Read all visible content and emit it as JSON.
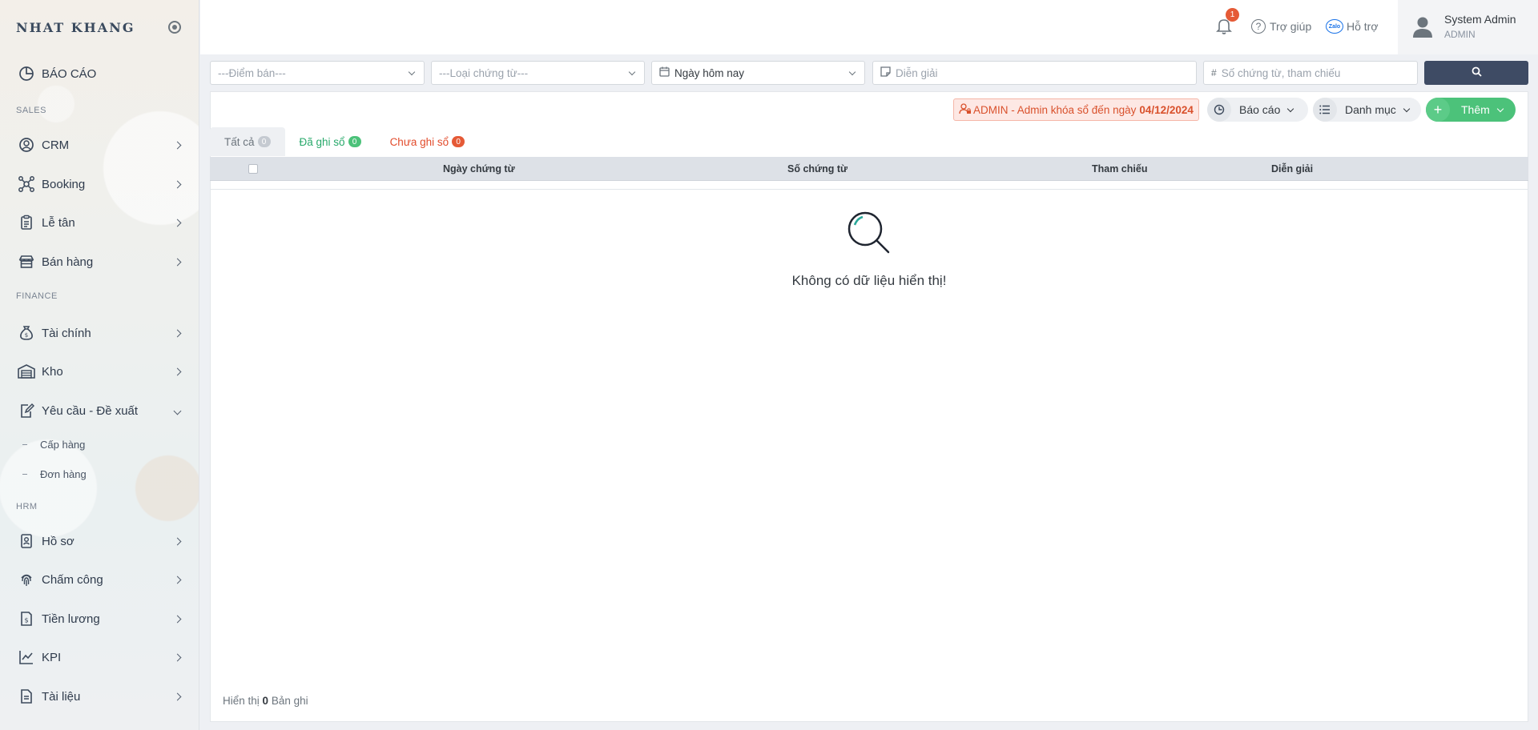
{
  "brand": {
    "name": "NHAT KHANG"
  },
  "sidebar": {
    "report": "BÁO CÁO",
    "sections": {
      "sales": "SALES",
      "finance": "FINANCE",
      "hrm": "HRM"
    },
    "items": {
      "crm": "CRM",
      "booking": "Booking",
      "reception": "Lễ tân",
      "sales": "Bán hàng",
      "finance": "Tài chính",
      "warehouse": "Kho",
      "requests": "Yêu cầu - Đề xuất",
      "hr_profile": "Hồ sơ",
      "timekeeping": "Chấm công",
      "salary": "Tiền lương",
      "kpi": "KPI",
      "documents": "Tài liệu"
    },
    "sub_items": {
      "supply": "Cấp hàng",
      "orders": "Đơn hàng"
    }
  },
  "header": {
    "notification_count": "1",
    "help": "Trợ giúp",
    "support_icon_text": "Zalo",
    "support": "Hỗ trợ",
    "user_name": "System Admin",
    "user_role": "ADMIN"
  },
  "filters": {
    "point_of_sale": "---Điểm bán---",
    "voucher_type": "---Loại chứng từ---",
    "date_range": "Ngày hôm nay",
    "description_placeholder": "Diễn giải",
    "voucher_number_placeholder": "Số chứng từ, tham chiếu"
  },
  "toolbar": {
    "lock_note": "ADMIN - Admin khóa sổ đến ngày",
    "lock_date": "04/12/2024",
    "report": "Báo cáo",
    "catalog": "Danh mục",
    "add": "Thêm"
  },
  "tabs": [
    {
      "label": "Tất cả",
      "count": "0"
    },
    {
      "label": "Đã ghi sổ",
      "count": "0"
    },
    {
      "label": "Chưa ghi sổ",
      "count": "0"
    }
  ],
  "table": {
    "columns": [
      "Ngày chứng từ",
      "Số chứng từ",
      "Tham chiếu",
      "Diễn giải"
    ],
    "empty_message": "Không có dữ liệu hiển thị!"
  },
  "footer": {
    "prefix": "Hiển thị",
    "count": "0",
    "suffix": "Bản ghi"
  },
  "colors": {
    "primary_dark": "#3e4b64",
    "success": "#4cc27a",
    "danger": "#e55a36",
    "tab_posted": "#28a96b",
    "tab_unposted": "#e24c2c"
  }
}
